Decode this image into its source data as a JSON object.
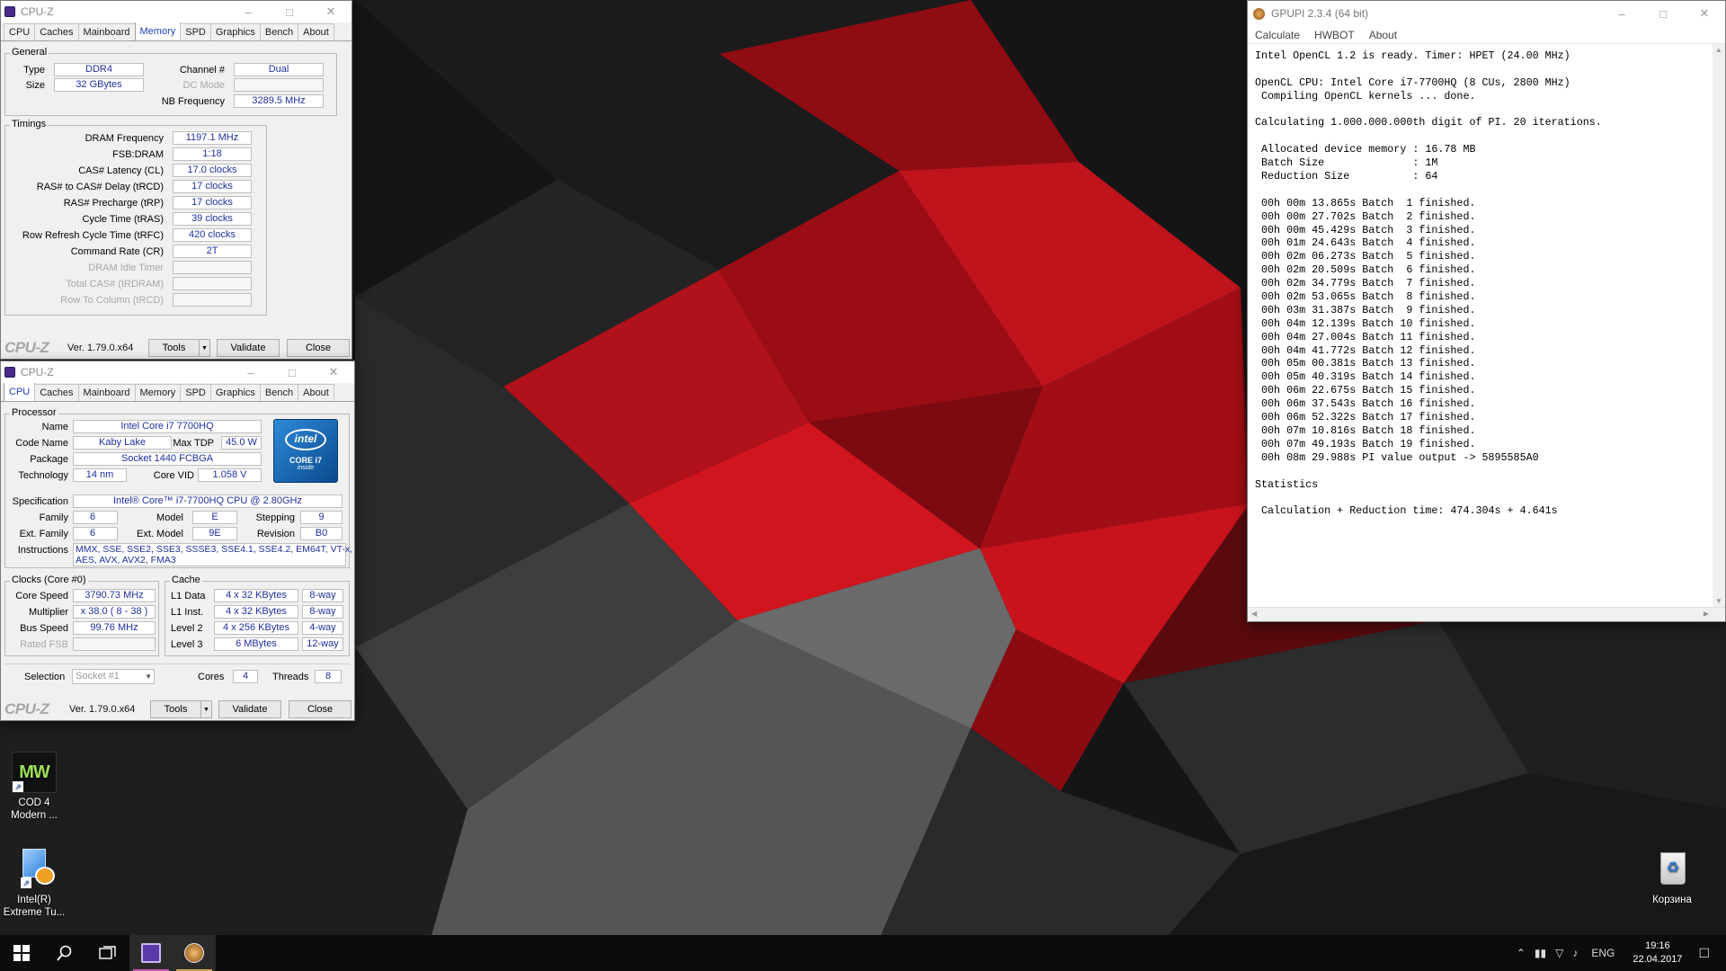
{
  "cpuz_memory": {
    "title": "CPU-Z",
    "tabs": [
      "CPU",
      "Caches",
      "Mainboard",
      "Memory",
      "SPD",
      "Graphics",
      "Bench",
      "About"
    ],
    "active_tab": "Memory",
    "general_legend": "General",
    "general": {
      "type_label": "Type",
      "type_value": "DDR4",
      "size_label": "Size",
      "size_value": "32 GBytes",
      "channel_label": "Channel #",
      "channel_value": "Dual",
      "dcmode_label": "DC Mode",
      "dcmode_value": "",
      "nbfreq_label": "NB Frequency",
      "nbfreq_value": "3289.5 MHz"
    },
    "timings_legend": "Timings",
    "timings": [
      {
        "label": "DRAM Frequency",
        "value": "1197.1 MHz",
        "disabled": false
      },
      {
        "label": "FSB:DRAM",
        "value": "1:18",
        "disabled": false
      },
      {
        "label": "CAS# Latency (CL)",
        "value": "17.0 clocks",
        "disabled": false
      },
      {
        "label": "RAS# to CAS# Delay (tRCD)",
        "value": "17 clocks",
        "disabled": false
      },
      {
        "label": "RAS# Precharge (tRP)",
        "value": "17 clocks",
        "disabled": false
      },
      {
        "label": "Cycle Time (tRAS)",
        "value": "39 clocks",
        "disabled": false
      },
      {
        "label": "Row Refresh Cycle Time (tRFC)",
        "value": "420 clocks",
        "disabled": false
      },
      {
        "label": "Command Rate (CR)",
        "value": "2T",
        "disabled": false
      },
      {
        "label": "DRAM Idle Timer",
        "value": "",
        "disabled": true
      },
      {
        "label": "Total CAS# (tRDRAM)",
        "value": "",
        "disabled": true
      },
      {
        "label": "Row To Column (tRCD)",
        "value": "",
        "disabled": true
      }
    ],
    "footer": {
      "brand": "CPU-Z",
      "version": "Ver. 1.79.0.x64",
      "tools": "Tools",
      "validate": "Validate",
      "close": "Close"
    }
  },
  "cpuz_cpu": {
    "title": "CPU-Z",
    "tabs": [
      "CPU",
      "Caches",
      "Mainboard",
      "Memory",
      "SPD",
      "Graphics",
      "Bench",
      "About"
    ],
    "active_tab": "CPU",
    "processor_legend": "Processor",
    "name_label": "Name",
    "name_value": "Intel Core i7 7700HQ",
    "codename_label": "Code Name",
    "codename_value": "Kaby Lake",
    "maxtdp_label": "Max TDP",
    "maxtdp_value": "45.0 W",
    "package_label": "Package",
    "package_value": "Socket 1440 FCBGA",
    "technology_label": "Technology",
    "technology_value": "14 nm",
    "corevid_label": "Core VID",
    "corevid_value": "1.058 V",
    "spec_label": "Specification",
    "spec_value": "Intel® Core™ i7-7700HQ CPU @ 2.80GHz",
    "family_label": "Family",
    "family_value": "6",
    "model_label": "Model",
    "model_value": "E",
    "stepping_label": "Stepping",
    "stepping_value": "9",
    "extfamily_label": "Ext. Family",
    "extfamily_value": "6",
    "extmodel_label": "Ext. Model",
    "extmodel_value": "9E",
    "revision_label": "Revision",
    "revision_value": "B0",
    "instructions_label": "Instructions",
    "instructions_line1": "MMX, SSE, SSE2, SSE3, SSSE3, SSE4.1, SSE4.2, EM64T, VT-x,",
    "instructions_line2": "AES, AVX, AVX2, FMA3",
    "logo": {
      "brand": "intel",
      "line1": "CORE i7",
      "line2": "inside"
    },
    "clocks_legend": "Clocks (Core #0)",
    "corespeed_label": "Core Speed",
    "corespeed_value": "3790.73 MHz",
    "multiplier_label": "Multiplier",
    "multiplier_value": "x 38.0 ( 8 - 38 )",
    "busspeed_label": "Bus Speed",
    "busspeed_value": "99.76 MHz",
    "ratedfsb_label": "Rated FSB",
    "ratedfsb_value": "",
    "cache_legend": "Cache",
    "cache": [
      {
        "label": "L1 Data",
        "size": "4 x 32 KBytes",
        "way": "8-way"
      },
      {
        "label": "L1 Inst.",
        "size": "4 x 32 KBytes",
        "way": "8-way"
      },
      {
        "label": "Level 2",
        "size": "4 x 256 KBytes",
        "way": "4-way"
      },
      {
        "label": "Level 3",
        "size": "6 MBytes",
        "way": "12-way"
      }
    ],
    "selection_label": "Selection",
    "selection_value": "Socket #1",
    "cores_label": "Cores",
    "cores_value": "4",
    "threads_label": "Threads",
    "threads_value": "8",
    "footer": {
      "brand": "CPU-Z",
      "version": "Ver. 1.79.0.x64",
      "tools": "Tools",
      "validate": "Validate",
      "close": "Close"
    }
  },
  "gpupi": {
    "title": "GPUPI 2.3.4 (64 bit)",
    "menu": [
      "Calculate",
      "HWBOT",
      "About"
    ],
    "lines": [
      "Intel OpenCL 1.2 is ready. Timer: HPET (24.00 MHz)",
      "",
      "OpenCL CPU: Intel Core i7-7700HQ (8 CUs, 2800 MHz)",
      " Compiling OpenCL kernels ... done.",
      "",
      "Calculating 1.000.000.000th digit of PI. 20 iterations.",
      "",
      " Allocated device memory : 16.78 MB",
      " Batch Size              : 1M",
      " Reduction Size          : 64",
      "",
      " 00h 00m 13.865s Batch  1 finished.",
      " 00h 00m 27.702s Batch  2 finished.",
      " 00h 00m 45.429s Batch  3 finished.",
      " 00h 01m 24.643s Batch  4 finished.",
      " 00h 02m 06.273s Batch  5 finished.",
      " 00h 02m 20.509s Batch  6 finished.",
      " 00h 02m 34.779s Batch  7 finished.",
      " 00h 02m 53.065s Batch  8 finished.",
      " 00h 03m 31.387s Batch  9 finished.",
      " 00h 04m 12.139s Batch 10 finished.",
      " 00h 04m 27.004s Batch 11 finished.",
      " 00h 04m 41.772s Batch 12 finished.",
      " 00h 05m 00.381s Batch 13 finished.",
      " 00h 05m 40.319s Batch 14 finished.",
      " 00h 06m 22.675s Batch 15 finished.",
      " 00h 06m 37.543s Batch 16 finished.",
      " 00h 06m 52.322s Batch 17 finished.",
      " 00h 07m 10.816s Batch 18 finished.",
      " 00h 07m 49.193s Batch 19 finished.",
      " 00h 08m 29.988s PI value output -> 5895585A0",
      "",
      "Statistics",
      "",
      " Calculation + Reduction time: 474.304s + 4.641s"
    ]
  },
  "desktop": {
    "icons": [
      {
        "name": "COD 4 Modern ...",
        "line1": "COD 4",
        "line2": "Modern ...",
        "glyph": "MW"
      },
      {
        "name": "Intel(R) Extreme Tu...",
        "line1": "Intel(R)",
        "line2": "Extreme Tu..."
      }
    ],
    "recycle_bin": "Корзина"
  },
  "taskbar": {
    "lang": "ENG",
    "time": "19:16",
    "date": "22.04.2017"
  },
  "colors": {
    "accent_value": "#1f2f9f",
    "wall_red": "#b3121b",
    "taskbar": "#0c0c0c"
  }
}
